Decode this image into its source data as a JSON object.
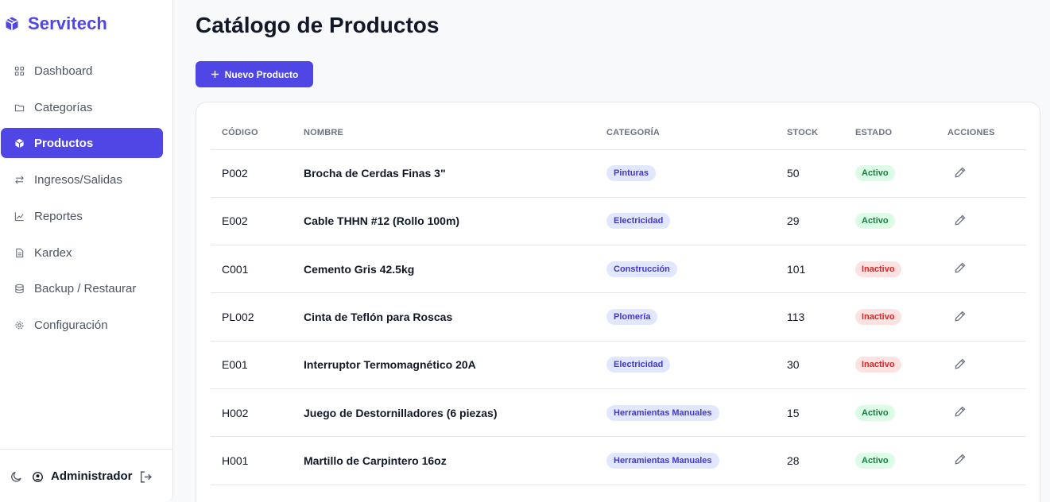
{
  "brand": {
    "name": "Servitech",
    "accent": "#4f46e5"
  },
  "sidebar": {
    "items": [
      {
        "label": "Dashboard",
        "icon": "grid-icon",
        "active": false
      },
      {
        "label": "Categorías",
        "icon": "folder-icon",
        "active": false
      },
      {
        "label": "Productos",
        "icon": "box-icon",
        "active": true
      },
      {
        "label": "Ingresos/Salidas",
        "icon": "swap-arrows-icon",
        "active": false
      },
      {
        "label": "Reportes",
        "icon": "line-chart-icon",
        "active": false
      },
      {
        "label": "Kardex",
        "icon": "document-icon",
        "active": false
      },
      {
        "label": "Backup / Restaurar",
        "icon": "database-icon",
        "active": false
      },
      {
        "label": "Configuración",
        "icon": "gear-icon",
        "active": false
      }
    ],
    "user": {
      "name": "Administrador"
    }
  },
  "main": {
    "title": "Catálogo de Productos",
    "new_button_label": "Nuevo Producto",
    "table": {
      "columns": [
        "CÓDIGO",
        "NOMBRE",
        "CATEGORÍA",
        "STOCK",
        "ESTADO",
        "ACCIONES"
      ],
      "rows": [
        {
          "code": "P002",
          "name": "Brocha de Cerdas Finas 3\"",
          "category": "Pinturas",
          "stock": "50",
          "status": "Activo",
          "active": true
        },
        {
          "code": "E002",
          "name": "Cable THHN #12 (Rollo 100m)",
          "category": "Electricidad",
          "stock": "29",
          "status": "Activo",
          "active": true
        },
        {
          "code": "C001",
          "name": "Cemento Gris 42.5kg",
          "category": "Construcción",
          "stock": "101",
          "status": "Inactivo",
          "active": false
        },
        {
          "code": "PL002",
          "name": "Cinta de Teflón para Roscas",
          "category": "Plomería",
          "stock": "113",
          "status": "Inactivo",
          "active": false
        },
        {
          "code": "E001",
          "name": "Interruptor Termomagnético 20A",
          "category": "Electricidad",
          "stock": "30",
          "status": "Inactivo",
          "active": false
        },
        {
          "code": "H002",
          "name": "Juego de Destornilladores (6 piezas)",
          "category": "Herramientas Manuales",
          "stock": "15",
          "status": "Activo",
          "active": true
        },
        {
          "code": "H001",
          "name": "Martillo de Carpintero 16oz",
          "category": "Herramientas Manuales",
          "stock": "28",
          "status": "Activo",
          "active": true
        }
      ]
    }
  }
}
